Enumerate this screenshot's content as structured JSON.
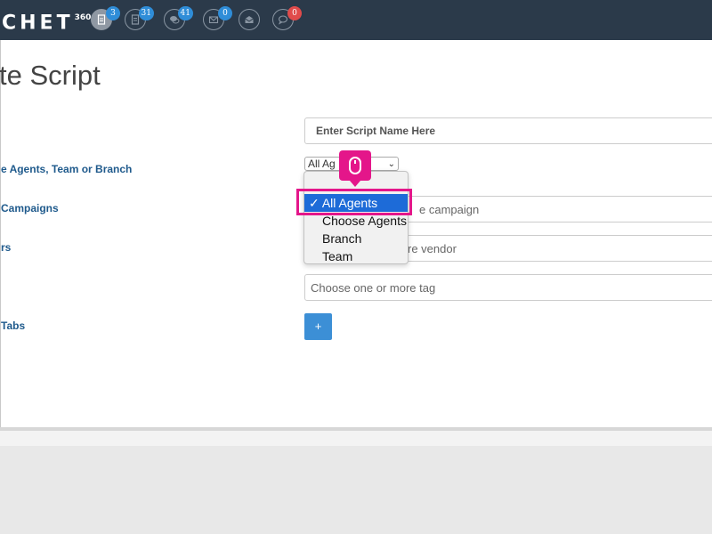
{
  "app": {
    "logo_text": "CHET",
    "logo_sup": "360"
  },
  "nav": {
    "items": [
      {
        "icon": "document-icon",
        "badge": "3"
      },
      {
        "icon": "document-list-icon",
        "badge": "31"
      },
      {
        "icon": "chat-bubbles-icon",
        "badge": "41"
      },
      {
        "icon": "envelope-icon",
        "badge": "0"
      },
      {
        "icon": "envelope-open-icon",
        "badge": ""
      },
      {
        "icon": "comment-icon",
        "badge": "0"
      }
    ]
  },
  "page": {
    "title": "te Script"
  },
  "form": {
    "script_name": {
      "placeholder": "Enter Script Name Here"
    },
    "agents": {
      "label": "e Agents, Team or Branch",
      "selected": "All Ag"
    },
    "campaigns": {
      "label": "Campaigns",
      "placeholder": "e campaign"
    },
    "vendors": {
      "label": "rs",
      "placeholder": "re vendor"
    },
    "tags": {
      "placeholder": "Choose one or more tag"
    },
    "tabs": {
      "label": "Tabs",
      "add_label": "+"
    }
  },
  "dropdown": {
    "options": [
      {
        "label": "✓ All Agents",
        "selected": true
      },
      {
        "label": "Choose Agents",
        "selected": false
      },
      {
        "label": "Branch",
        "selected": false
      },
      {
        "label": "Team",
        "selected": false
      }
    ]
  },
  "colors": {
    "topbar": "#2b3a4a",
    "badge_blue": "#2f8dd8",
    "badge_red": "#e04b4b",
    "label_blue": "#1f5a8c",
    "button_blue": "#3c8fd6",
    "selection_blue": "#1d6bd8",
    "highlight_pink": "#e4168a"
  }
}
